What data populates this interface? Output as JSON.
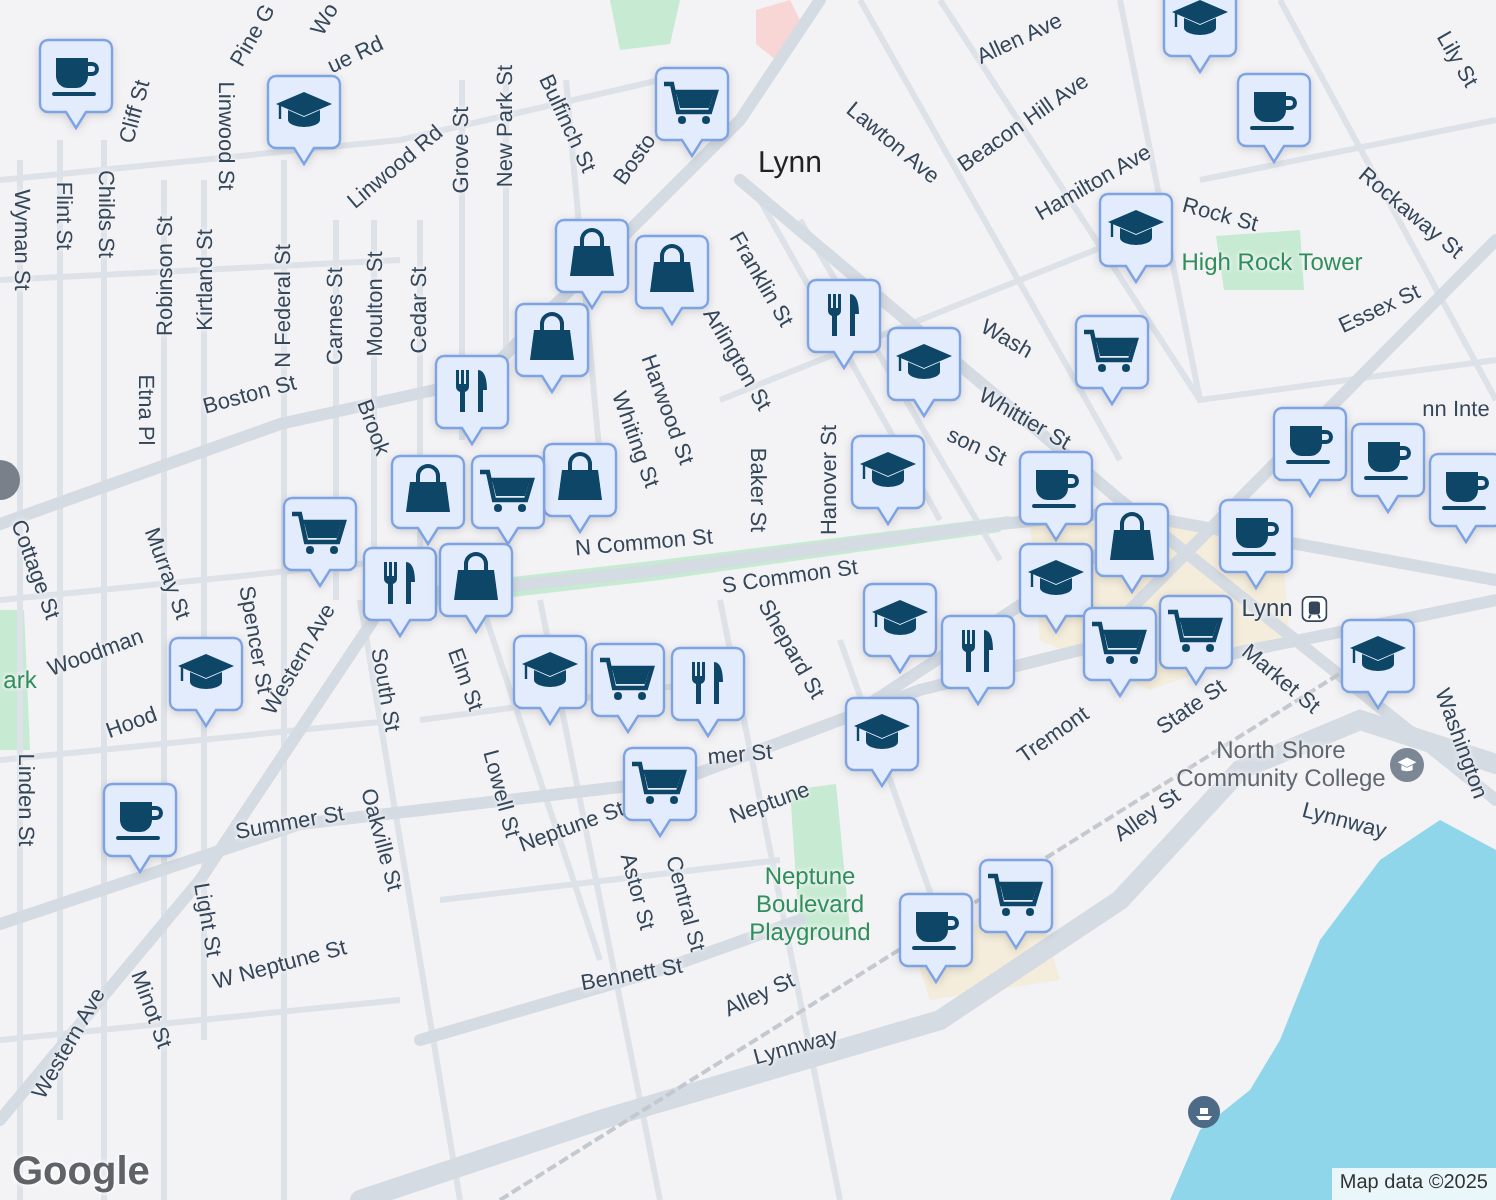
{
  "map": {
    "labels": [
      {
        "kind": "street",
        "text": "Pine G"
      },
      {
        "kind": "street",
        "text": "Wo"
      },
      {
        "kind": "street",
        "text": "ue Rd"
      },
      {
        "kind": "street",
        "text": "Linwood Rd"
      },
      {
        "kind": "street",
        "text": "Cliff St"
      },
      {
        "kind": "street",
        "text": "Linwood St"
      },
      {
        "kind": "street",
        "text": "Wyman St"
      },
      {
        "kind": "street",
        "text": "Flint St"
      },
      {
        "kind": "street",
        "text": "Childs St"
      },
      {
        "kind": "street",
        "text": "Robinson St"
      },
      {
        "kind": "street",
        "text": "Kirtland St"
      },
      {
        "kind": "street",
        "text": "N Federal St"
      },
      {
        "kind": "street",
        "text": "Carnes St"
      },
      {
        "kind": "street",
        "text": "Moulton St"
      },
      {
        "kind": "street",
        "text": "Cedar St"
      },
      {
        "kind": "street",
        "text": "Grove St"
      },
      {
        "kind": "street",
        "text": "New Park St"
      },
      {
        "kind": "street",
        "text": "Bulfinch St"
      },
      {
        "kind": "street",
        "text": "Bosto"
      },
      {
        "kind": "street",
        "text": "Boston St"
      },
      {
        "kind": "street",
        "text": "Etna Pl"
      },
      {
        "kind": "street",
        "text": "Brook"
      },
      {
        "kind": "street",
        "text": "Harwood St"
      },
      {
        "kind": "street",
        "text": "Whiting St"
      },
      {
        "kind": "street",
        "text": "Arlington St"
      },
      {
        "kind": "street",
        "text": "Franklin St"
      },
      {
        "kind": "street",
        "text": "Baker St"
      },
      {
        "kind": "street",
        "text": "Hanover St"
      },
      {
        "kind": "street",
        "text": "N Common St"
      },
      {
        "kind": "street",
        "text": "S Common St"
      },
      {
        "kind": "street",
        "text": "Shepard St"
      },
      {
        "kind": "street",
        "text": "Elm St"
      },
      {
        "kind": "street",
        "text": "South St"
      },
      {
        "kind": "street",
        "text": "Western Ave"
      },
      {
        "kind": "street",
        "text": "Spencer St"
      },
      {
        "kind": "street",
        "text": "Murray St"
      },
      {
        "kind": "street",
        "text": "Cottage St"
      },
      {
        "kind": "street",
        "text": "Woodman"
      },
      {
        "kind": "street",
        "text": "Hood"
      },
      {
        "kind": "street",
        "text": "Linden St"
      },
      {
        "kind": "street",
        "text": "Summer St"
      },
      {
        "kind": "street",
        "text": "Oakville St"
      },
      {
        "kind": "street",
        "text": "Lowell St"
      },
      {
        "kind": "street",
        "text": "Neptune St"
      },
      {
        "kind": "street",
        "text": "Astor St"
      },
      {
        "kind": "street",
        "text": "Central St"
      },
      {
        "kind": "street",
        "text": "mer St"
      },
      {
        "kind": "street",
        "text": "Light St"
      },
      {
        "kind": "street",
        "text": "Western Ave"
      },
      {
        "kind": "street",
        "text": "Minot St"
      },
      {
        "kind": "street",
        "text": "W Neptune St"
      },
      {
        "kind": "street",
        "text": "Bennett St"
      },
      {
        "kind": "street",
        "text": "Alley St"
      },
      {
        "kind": "street",
        "text": "Lynnway"
      },
      {
        "kind": "street",
        "text": "Lynnway"
      },
      {
        "kind": "street",
        "text": "Alley St"
      },
      {
        "kind": "street",
        "text": "Neptune"
      },
      {
        "kind": "street",
        "text": "Tremont"
      },
      {
        "kind": "street",
        "text": "State St"
      },
      {
        "kind": "street",
        "text": "Market St"
      },
      {
        "kind": "street",
        "text": "Washington"
      },
      {
        "kind": "street",
        "text": "Wash"
      },
      {
        "kind": "street",
        "text": "Whittier St"
      },
      {
        "kind": "street",
        "text": "son St"
      },
      {
        "kind": "street",
        "text": "Lawton Ave"
      },
      {
        "kind": "street",
        "text": "Beacon Hill Ave"
      },
      {
        "kind": "street",
        "text": "Hamilton Ave"
      },
      {
        "kind": "street",
        "text": "Allen Ave"
      },
      {
        "kind": "street",
        "text": "Rock St"
      },
      {
        "kind": "street",
        "text": "Rockaway St"
      },
      {
        "kind": "street",
        "text": "Essex St"
      },
      {
        "kind": "street",
        "text": "Lily St"
      },
      {
        "kind": "town",
        "text": "Lynn"
      },
      {
        "kind": "park",
        "text": "High Rock Tower"
      },
      {
        "kind": "college",
        "text": "North Shore Community College"
      },
      {
        "kind": "park",
        "text": "Neptune Boulevard Playground"
      },
      {
        "kind": "station",
        "text": "Lynn"
      },
      {
        "kind": "street",
        "text": "nn Inte"
      },
      {
        "kind": "park",
        "text": "ark"
      }
    ],
    "markers": [
      {
        "kind": "cafe"
      },
      {
        "kind": "school"
      },
      {
        "kind": "grocery"
      },
      {
        "kind": "school"
      },
      {
        "kind": "cafe"
      },
      {
        "kind": "school"
      },
      {
        "kind": "shopping"
      },
      {
        "kind": "shopping"
      },
      {
        "kind": "shopping"
      },
      {
        "kind": "restaurant"
      },
      {
        "kind": "restaurant"
      },
      {
        "kind": "school"
      },
      {
        "kind": "grocery"
      },
      {
        "kind": "school"
      },
      {
        "kind": "cafe"
      },
      {
        "kind": "school"
      },
      {
        "kind": "shopping"
      },
      {
        "kind": "grocery"
      },
      {
        "kind": "cafe"
      },
      {
        "kind": "cafe"
      },
      {
        "kind": "cafe"
      },
      {
        "kind": "cafe"
      },
      {
        "kind": "shopping"
      },
      {
        "kind": "shopping"
      },
      {
        "kind": "restaurant"
      },
      {
        "kind": "grocery"
      },
      {
        "kind": "shopping"
      },
      {
        "kind": "grocery"
      },
      {
        "kind": "school"
      },
      {
        "kind": "restaurant"
      },
      {
        "kind": "grocery"
      },
      {
        "kind": "school"
      },
      {
        "kind": "school"
      },
      {
        "kind": "grocery"
      },
      {
        "kind": "restaurant"
      },
      {
        "kind": "grocery"
      },
      {
        "kind": "school"
      },
      {
        "kind": "cafe"
      },
      {
        "kind": "grocery"
      },
      {
        "kind": "cafe"
      },
      {
        "kind": "school"
      }
    ]
  },
  "attribution": {
    "logo": "Google",
    "text": "Map data ©2025"
  }
}
